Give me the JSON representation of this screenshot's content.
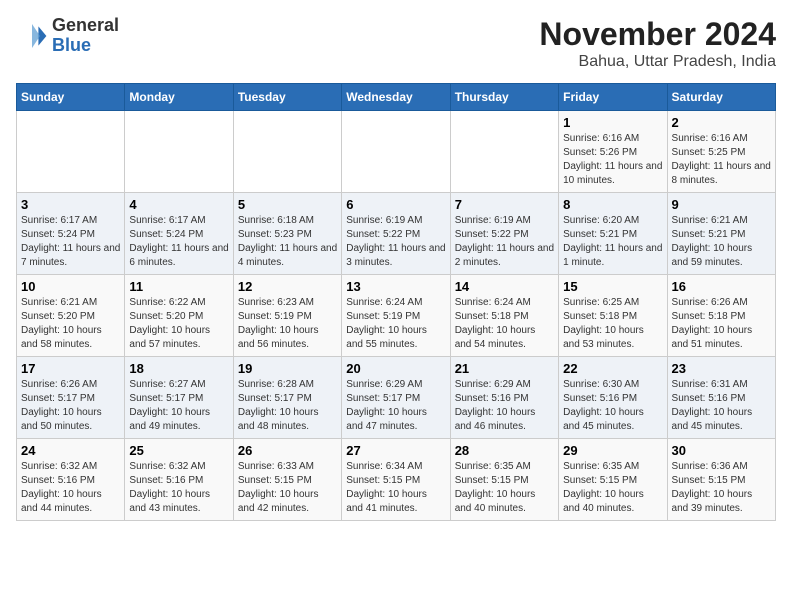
{
  "logo": {
    "general": "General",
    "blue": "Blue"
  },
  "title": "November 2024",
  "subtitle": "Bahua, Uttar Pradesh, India",
  "weekdays": [
    "Sunday",
    "Monday",
    "Tuesday",
    "Wednesday",
    "Thursday",
    "Friday",
    "Saturday"
  ],
  "weeks": [
    [
      {
        "day": "",
        "info": ""
      },
      {
        "day": "",
        "info": ""
      },
      {
        "day": "",
        "info": ""
      },
      {
        "day": "",
        "info": ""
      },
      {
        "day": "",
        "info": ""
      },
      {
        "day": "1",
        "info": "Sunrise: 6:16 AM\nSunset: 5:26 PM\nDaylight: 11 hours and 10 minutes."
      },
      {
        "day": "2",
        "info": "Sunrise: 6:16 AM\nSunset: 5:25 PM\nDaylight: 11 hours and 8 minutes."
      }
    ],
    [
      {
        "day": "3",
        "info": "Sunrise: 6:17 AM\nSunset: 5:24 PM\nDaylight: 11 hours and 7 minutes."
      },
      {
        "day": "4",
        "info": "Sunrise: 6:17 AM\nSunset: 5:24 PM\nDaylight: 11 hours and 6 minutes."
      },
      {
        "day": "5",
        "info": "Sunrise: 6:18 AM\nSunset: 5:23 PM\nDaylight: 11 hours and 4 minutes."
      },
      {
        "day": "6",
        "info": "Sunrise: 6:19 AM\nSunset: 5:22 PM\nDaylight: 11 hours and 3 minutes."
      },
      {
        "day": "7",
        "info": "Sunrise: 6:19 AM\nSunset: 5:22 PM\nDaylight: 11 hours and 2 minutes."
      },
      {
        "day": "8",
        "info": "Sunrise: 6:20 AM\nSunset: 5:21 PM\nDaylight: 11 hours and 1 minute."
      },
      {
        "day": "9",
        "info": "Sunrise: 6:21 AM\nSunset: 5:21 PM\nDaylight: 10 hours and 59 minutes."
      }
    ],
    [
      {
        "day": "10",
        "info": "Sunrise: 6:21 AM\nSunset: 5:20 PM\nDaylight: 10 hours and 58 minutes."
      },
      {
        "day": "11",
        "info": "Sunrise: 6:22 AM\nSunset: 5:20 PM\nDaylight: 10 hours and 57 minutes."
      },
      {
        "day": "12",
        "info": "Sunrise: 6:23 AM\nSunset: 5:19 PM\nDaylight: 10 hours and 56 minutes."
      },
      {
        "day": "13",
        "info": "Sunrise: 6:24 AM\nSunset: 5:19 PM\nDaylight: 10 hours and 55 minutes."
      },
      {
        "day": "14",
        "info": "Sunrise: 6:24 AM\nSunset: 5:18 PM\nDaylight: 10 hours and 54 minutes."
      },
      {
        "day": "15",
        "info": "Sunrise: 6:25 AM\nSunset: 5:18 PM\nDaylight: 10 hours and 53 minutes."
      },
      {
        "day": "16",
        "info": "Sunrise: 6:26 AM\nSunset: 5:18 PM\nDaylight: 10 hours and 51 minutes."
      }
    ],
    [
      {
        "day": "17",
        "info": "Sunrise: 6:26 AM\nSunset: 5:17 PM\nDaylight: 10 hours and 50 minutes."
      },
      {
        "day": "18",
        "info": "Sunrise: 6:27 AM\nSunset: 5:17 PM\nDaylight: 10 hours and 49 minutes."
      },
      {
        "day": "19",
        "info": "Sunrise: 6:28 AM\nSunset: 5:17 PM\nDaylight: 10 hours and 48 minutes."
      },
      {
        "day": "20",
        "info": "Sunrise: 6:29 AM\nSunset: 5:17 PM\nDaylight: 10 hours and 47 minutes."
      },
      {
        "day": "21",
        "info": "Sunrise: 6:29 AM\nSunset: 5:16 PM\nDaylight: 10 hours and 46 minutes."
      },
      {
        "day": "22",
        "info": "Sunrise: 6:30 AM\nSunset: 5:16 PM\nDaylight: 10 hours and 45 minutes."
      },
      {
        "day": "23",
        "info": "Sunrise: 6:31 AM\nSunset: 5:16 PM\nDaylight: 10 hours and 45 minutes."
      }
    ],
    [
      {
        "day": "24",
        "info": "Sunrise: 6:32 AM\nSunset: 5:16 PM\nDaylight: 10 hours and 44 minutes."
      },
      {
        "day": "25",
        "info": "Sunrise: 6:32 AM\nSunset: 5:16 PM\nDaylight: 10 hours and 43 minutes."
      },
      {
        "day": "26",
        "info": "Sunrise: 6:33 AM\nSunset: 5:15 PM\nDaylight: 10 hours and 42 minutes."
      },
      {
        "day": "27",
        "info": "Sunrise: 6:34 AM\nSunset: 5:15 PM\nDaylight: 10 hours and 41 minutes."
      },
      {
        "day": "28",
        "info": "Sunrise: 6:35 AM\nSunset: 5:15 PM\nDaylight: 10 hours and 40 minutes."
      },
      {
        "day": "29",
        "info": "Sunrise: 6:35 AM\nSunset: 5:15 PM\nDaylight: 10 hours and 40 minutes."
      },
      {
        "day": "30",
        "info": "Sunrise: 6:36 AM\nSunset: 5:15 PM\nDaylight: 10 hours and 39 minutes."
      }
    ]
  ]
}
